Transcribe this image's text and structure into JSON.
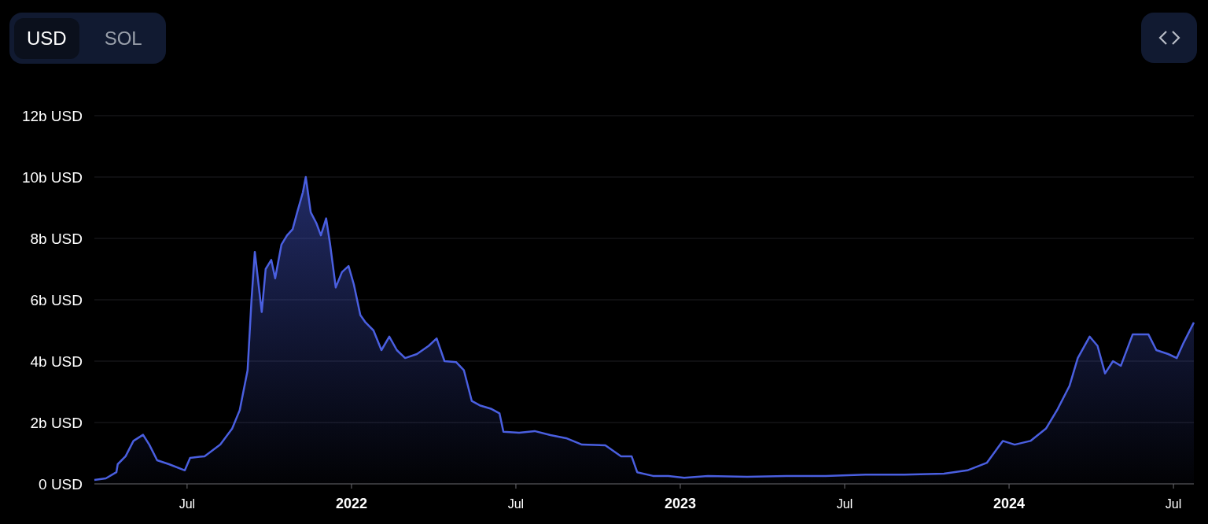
{
  "currency_toggle": [
    {
      "label": "USD",
      "selected": true
    },
    {
      "label": "SOL",
      "selected": false
    }
  ],
  "chart": {
    "chart_data": {
      "type": "area",
      "grid": true,
      "xlim": [
        2021.218,
        2024.562
      ],
      "ylim": [
        0,
        12
      ],
      "xticks": [
        {
          "value": 2021.5,
          "label": "Jul"
        },
        {
          "value": 2022,
          "label": "2022"
        },
        {
          "value": 2022.5,
          "label": "Jul"
        },
        {
          "value": 2023,
          "label": "2023"
        },
        {
          "value": 2023.5,
          "label": "Jul"
        },
        {
          "value": 2024,
          "label": "2024"
        },
        {
          "value": 2024.5,
          "label": "Jul"
        }
      ],
      "yticks": [
        {
          "value": 0,
          "label": "0 USD"
        },
        {
          "value": 2,
          "label": "2b USD"
        },
        {
          "value": 4,
          "label": "4b USD"
        },
        {
          "value": 6,
          "label": "6b USD"
        },
        {
          "value": 8,
          "label": "8b USD"
        },
        {
          "value": 10,
          "label": "10b USD"
        },
        {
          "value": 12,
          "label": "12b USD"
        }
      ],
      "x": [
        2021.218,
        2021.253,
        2021.285,
        2021.289,
        2021.313,
        2021.337,
        2021.366,
        2021.385,
        2021.409,
        2021.445,
        2021.493,
        2021.509,
        2021.553,
        2021.601,
        2021.637,
        2021.66,
        2021.684,
        2021.696,
        2021.706,
        2021.727,
        2021.739,
        2021.756,
        2021.768,
        2021.787,
        2021.804,
        2021.821,
        2021.835,
        2021.852,
        2021.861,
        2021.876,
        2021.893,
        2021.907,
        2021.923,
        2021.935,
        2021.952,
        2021.971,
        2021.991,
        2022.007,
        2022.027,
        2022.043,
        2022.067,
        2022.091,
        2022.115,
        2022.138,
        2022.163,
        2022.199,
        2022.235,
        2022.259,
        2022.283,
        2022.318,
        2022.342,
        2022.366,
        2022.39,
        2022.426,
        2022.45,
        2022.462,
        2022.51,
        2022.557,
        2022.605,
        2022.653,
        2022.701,
        2022.772,
        2022.82,
        2022.852,
        2022.869,
        2022.917,
        2022.964,
        2023.012,
        2023.084,
        2023.203,
        2023.323,
        2023.442,
        2023.563,
        2023.682,
        2023.802,
        2023.873,
        2023.933,
        2023.981,
        2024.017,
        2024.065,
        2024.112,
        2024.148,
        2024.184,
        2024.209,
        2024.245,
        2024.269,
        2024.292,
        2024.316,
        2024.34,
        2024.376,
        2024.424,
        2024.448,
        2024.484,
        2024.51,
        2024.531,
        2024.562
      ],
      "series": [
        {
          "color": "#4a5fe0",
          "values": [
            0.13,
            0.18,
            0.38,
            0.64,
            0.9,
            1.4,
            1.6,
            1.28,
            0.77,
            0.64,
            0.44,
            0.85,
            0.9,
            1.28,
            1.8,
            2.4,
            3.7,
            6.0,
            7.56,
            5.6,
            7.0,
            7.3,
            6.7,
            7.8,
            8.1,
            8.3,
            8.85,
            9.5,
            10.0,
            8.85,
            8.5,
            8.1,
            8.65,
            7.8,
            6.4,
            6.9,
            7.1,
            6.5,
            5.5,
            5.26,
            5.0,
            4.36,
            4.8,
            4.36,
            4.1,
            4.23,
            4.5,
            4.74,
            4.0,
            3.97,
            3.7,
            2.7,
            2.56,
            2.44,
            2.3,
            1.7,
            1.67,
            1.72,
            1.59,
            1.49,
            1.28,
            1.26,
            0.9,
            0.9,
            0.38,
            0.26,
            0.26,
            0.2,
            0.26,
            0.23,
            0.26,
            0.26,
            0.3,
            0.3,
            0.33,
            0.44,
            0.69,
            1.4,
            1.28,
            1.4,
            1.8,
            2.44,
            3.2,
            4.1,
            4.8,
            4.5,
            3.6,
            4.0,
            3.85,
            4.87,
            4.87,
            4.36,
            4.23,
            4.1,
            4.6,
            5.26
          ]
        }
      ]
    }
  }
}
